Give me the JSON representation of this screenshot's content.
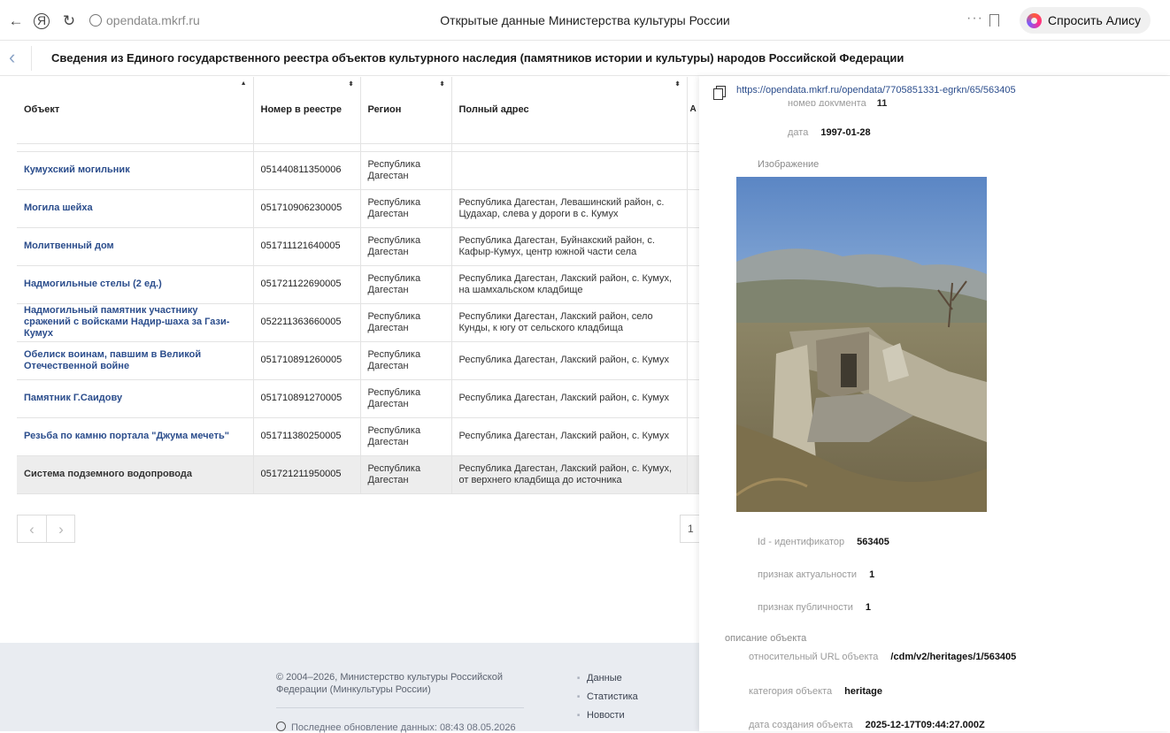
{
  "browser": {
    "url": "opendata.mkrf.ru",
    "title": "Открытые данные Министерства культуры России",
    "alice_label": "Спросить Алису AI"
  },
  "page": {
    "title": "Сведения из Единого государственного реестра объектов культурного наследия (памятников истории и культуры) народов Российской Федерации"
  },
  "table": {
    "headers": [
      "Объект",
      "Номер в реестре",
      "Регион",
      "Полный адрес",
      "А п"
    ],
    "rows": [
      {
        "object": "Кумухский могильник",
        "number": "051440811350006",
        "region": "Республика Дагестан",
        "address": ""
      },
      {
        "object": "Могила шейха",
        "number": "051710906230005",
        "region": "Республика Дагестан",
        "address": "Республика Дагестан, Левашинский район, с. Цудахар, слева у дороги в с. Кумух"
      },
      {
        "object": "Молитвенный дом",
        "number": "051711121640005",
        "region": "Республика Дагестан",
        "address": "Республика Дагестан, Буйнакский район, с. Кафыр-Кумух, центр южной части села"
      },
      {
        "object": "Надмогильные стелы (2 ед.)",
        "number": "051721122690005",
        "region": "Республика Дагестан",
        "address": "Республика Дагестан, Лакский район, с. Кумух, на шамхальском кладбище"
      },
      {
        "object": "Надмогильный памятник участнику сражений с войсками Надир-шаха за Гази-Кумух",
        "number": "052211363660005",
        "region": "Республика Дагестан",
        "address": "Республики Дагестан, Лакский район, село Кунды, к югу от сельского кладбища"
      },
      {
        "object": "Обелиск воинам, павшим в Великой Отечественной войне",
        "number": "051710891260005",
        "region": "Республика Дагестан",
        "address": "Республика Дагестан, Лакский район, с. Кумух"
      },
      {
        "object": "Памятник Г.Саидову",
        "number": "051710891270005",
        "region": "Республика Дагестан",
        "address": "Республика Дагестан, Лакский район, с. Кумух"
      },
      {
        "object": "Резьба по камню портала \"Джума мечеть\"",
        "number": "051711380250005",
        "region": "Республика Дагестан",
        "address": "Республика Дагестан, Лакский район, с. Кумух"
      },
      {
        "object": "Система подземного водопровода",
        "number": "051721211950005",
        "region": "Республика Дагестан",
        "address": "Республика Дагестан, Лакский район, с. Кумух, от верхнего кладбища до источника"
      }
    ]
  },
  "pagination": {
    "prev": "‹",
    "next": "›",
    "page": "1"
  },
  "footer": {
    "copyright": "© 2004–2026, Министерство культуры Российской Федерации (Минкультуры России)",
    "updated": "Последнее обновление данных: 08:43 08.05.2026",
    "links": [
      "Данные",
      "Статистика",
      "Новости"
    ]
  },
  "panel": {
    "url": "https://opendata.mkrf.ru/opendata/7705851331-egrkn/65/563405",
    "doc_number_label": "номер документа",
    "doc_number_value": "11",
    "date_label": "дата",
    "date_value": "1997-01-28",
    "image_label": "Изображение",
    "id_label": "Id - идентификатор",
    "id_value": "563405",
    "actual_label": "признак актуальности",
    "actual_value": "1",
    "public_label": "признак публичности",
    "public_value": "1",
    "description_label": "описание объекта",
    "rel_url_label": "относительный URL объекта",
    "rel_url_value": "/cdm/v2/heritages/1/563405",
    "category_label": "категория объекта",
    "category_value": "heritage",
    "created_label": "дата создания объекта",
    "created_value": "2025-12-17T09:44:27.000Z"
  }
}
